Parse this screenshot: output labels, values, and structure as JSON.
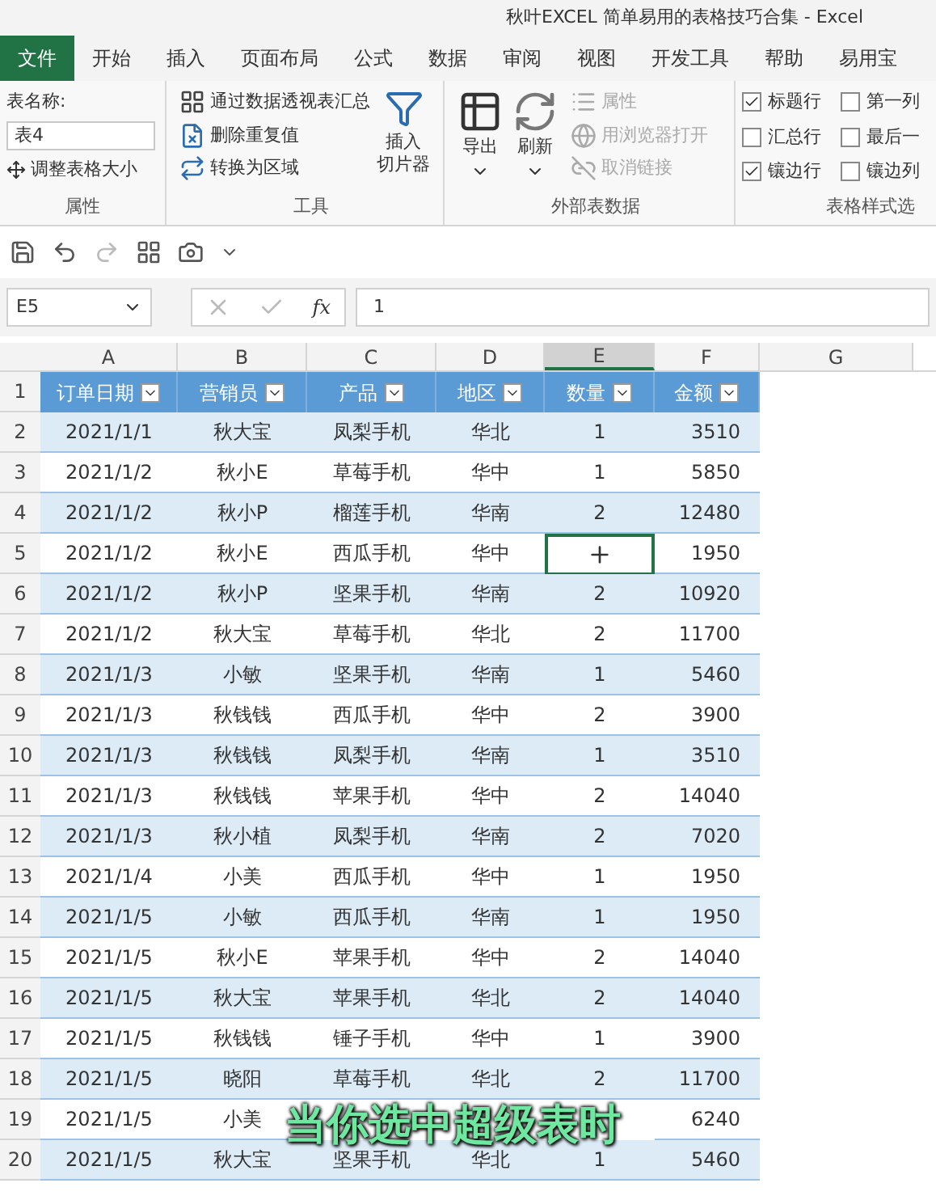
{
  "window": {
    "title": "秋叶EXCEL 简单易用的表格技巧合集  -  Excel"
  },
  "tabs": [
    {
      "label": "文件",
      "selected": false,
      "kind": "file"
    },
    {
      "label": "开始",
      "selected": false,
      "kind": "tab"
    },
    {
      "label": "插入",
      "selected": false,
      "kind": "tab"
    },
    {
      "label": "页面布局",
      "selected": false,
      "kind": "tab"
    },
    {
      "label": "公式",
      "selected": false,
      "kind": "tab"
    },
    {
      "label": "数据",
      "selected": false,
      "kind": "tab"
    },
    {
      "label": "审阅",
      "selected": false,
      "kind": "tab"
    },
    {
      "label": "视图",
      "selected": false,
      "kind": "tab"
    },
    {
      "label": "开发工具",
      "selected": false,
      "kind": "tab"
    },
    {
      "label": "帮助",
      "selected": false,
      "kind": "tab"
    },
    {
      "label": "易用宝",
      "selected": false,
      "kind": "tab"
    }
  ],
  "ribbon": {
    "properties": {
      "name_label": "表名称:",
      "name_value": "表4",
      "resize": "调整表格大小",
      "group": "属性"
    },
    "tools": {
      "buttons": [
        {
          "label": "通过数据透视表汇总",
          "kind": "pivot"
        },
        {
          "label": "删除重复值",
          "kind": "dedupe"
        },
        {
          "label": "转换为区域",
          "kind": "convert"
        }
      ],
      "slicer": [
        "插入",
        "切片器"
      ],
      "group": "工具"
    },
    "external": {
      "export": "导出",
      "refresh": "刷新",
      "buttons": [
        {
          "label": "属性",
          "disabled": true,
          "kind": "props"
        },
        {
          "label": "用浏览器打开",
          "disabled": true,
          "kind": "browser"
        },
        {
          "label": "取消链接",
          "disabled": true,
          "kind": "unlink"
        }
      ],
      "group": "外部表数据"
    },
    "style_options": {
      "options": [
        {
          "label": "标题行",
          "checked": true
        },
        {
          "label": "汇总行",
          "checked": false
        },
        {
          "label": "镶边行",
          "checked": true
        },
        {
          "label": "第一列",
          "checked": false
        },
        {
          "label": "最后一",
          "checked": false
        },
        {
          "label": "镶边列",
          "checked": false
        }
      ],
      "group": "表格样式选"
    }
  },
  "formula_bar": {
    "name_box": "E5",
    "function_label": "fx",
    "value": "1"
  },
  "sheet": {
    "columns": [
      {
        "label": "A",
        "selected": false
      },
      {
        "label": "B",
        "selected": false
      },
      {
        "label": "C",
        "selected": false
      },
      {
        "label": "D",
        "selected": false
      },
      {
        "label": "E",
        "selected": true
      },
      {
        "label": "F",
        "selected": false
      },
      {
        "label": "G",
        "selected": false
      }
    ],
    "header_row": "1",
    "headers": [
      "订单日期",
      "营销员",
      "产品",
      "地区",
      "数量",
      "金额"
    ],
    "rows": [
      {
        "row_number": "2",
        "cells": [
          "2021/1/1",
          "秋大宝",
          "凤梨手机",
          "华北",
          "1",
          "3510"
        ],
        "selected": false
      },
      {
        "row_number": "3",
        "cells": [
          "2021/1/2",
          "秋小E",
          "草莓手机",
          "华中",
          "1",
          "5850"
        ],
        "selected": false
      },
      {
        "row_number": "4",
        "cells": [
          "2021/1/2",
          "秋小P",
          "榴莲手机",
          "华南",
          "2",
          "12480"
        ],
        "selected": false
      },
      {
        "row_number": "5",
        "cells": [
          "2021/1/2",
          "秋小E",
          "西瓜手机",
          "华中",
          null,
          "1950"
        ],
        "selected": true
      },
      {
        "row_number": "6",
        "cells": [
          "2021/1/2",
          "秋小P",
          "坚果手机",
          "华南",
          "2",
          "10920"
        ],
        "selected": false
      },
      {
        "row_number": "7",
        "cells": [
          "2021/1/2",
          "秋大宝",
          "草莓手机",
          "华北",
          "2",
          "11700"
        ],
        "selected": false
      },
      {
        "row_number": "8",
        "cells": [
          "2021/1/3",
          "小敏",
          "坚果手机",
          "华南",
          "1",
          "5460"
        ],
        "selected": false
      },
      {
        "row_number": "9",
        "cells": [
          "2021/1/3",
          "秋钱钱",
          "西瓜手机",
          "华中",
          "2",
          "3900"
        ],
        "selected": false
      },
      {
        "row_number": "10",
        "cells": [
          "2021/1/3",
          "秋钱钱",
          "凤梨手机",
          "华南",
          "1",
          "3510"
        ],
        "selected": false
      },
      {
        "row_number": "11",
        "cells": [
          "2021/1/3",
          "秋钱钱",
          "苹果手机",
          "华中",
          "2",
          "14040"
        ],
        "selected": false
      },
      {
        "row_number": "12",
        "cells": [
          "2021/1/3",
          "秋小植",
          "凤梨手机",
          "华南",
          "2",
          "7020"
        ],
        "selected": false
      },
      {
        "row_number": "13",
        "cells": [
          "2021/1/4",
          "小美",
          "西瓜手机",
          "华中",
          "1",
          "1950"
        ],
        "selected": false
      },
      {
        "row_number": "14",
        "cells": [
          "2021/1/5",
          "小敏",
          "西瓜手机",
          "华南",
          "1",
          "1950"
        ],
        "selected": false
      },
      {
        "row_number": "15",
        "cells": [
          "2021/1/5",
          "秋小E",
          "苹果手机",
          "华中",
          "2",
          "14040"
        ],
        "selected": false
      },
      {
        "row_number": "16",
        "cells": [
          "2021/1/5",
          "秋大宝",
          "苹果手机",
          "华北",
          "2",
          "14040"
        ],
        "selected": false
      },
      {
        "row_number": "17",
        "cells": [
          "2021/1/5",
          "秋钱钱",
          "锤子手机",
          "华中",
          "1",
          "3900"
        ],
        "selected": false
      },
      {
        "row_number": "18",
        "cells": [
          "2021/1/5",
          "晓阳",
          "草莓手机",
          "华北",
          "2",
          "11700"
        ],
        "selected": false
      },
      {
        "row_number": "19",
        "cells": [
          "2021/1/5",
          "小美",
          null,
          null,
          null,
          "6240"
        ],
        "selected": false
      },
      {
        "row_number": "20",
        "cells": [
          "2021/1/5",
          "秋大宝",
          "坚果手机",
          "华北",
          "1",
          "5460"
        ],
        "selected": false
      }
    ]
  },
  "caption": "当你选中超级表时"
}
